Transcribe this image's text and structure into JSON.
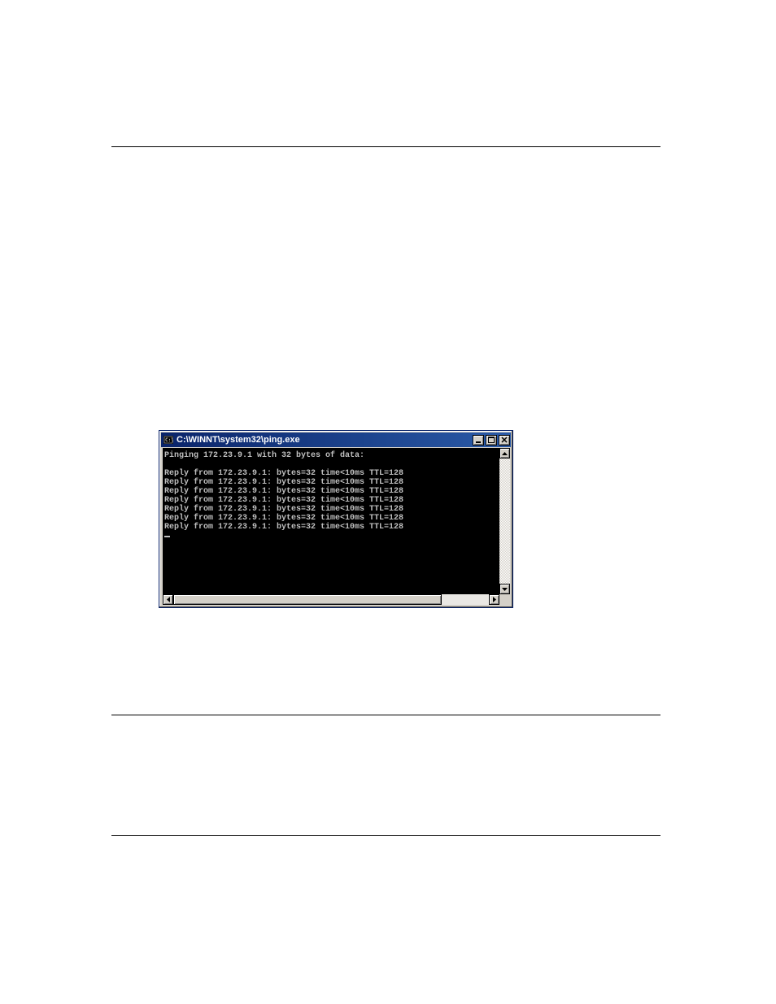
{
  "window": {
    "title": "C:\\WINNT\\system32\\ping.exe"
  },
  "console": {
    "header": "Pinging 172.23.9.1 with 32 bytes of data:",
    "lines": [
      "Reply from 172.23.9.1: bytes=32 time<10ms TTL=128",
      "Reply from 172.23.9.1: bytes=32 time<10ms TTL=128",
      "Reply from 172.23.9.1: bytes=32 time<10ms TTL=128",
      "Reply from 172.23.9.1: bytes=32 time<10ms TTL=128",
      "Reply from 172.23.9.1: bytes=32 time<10ms TTL=128",
      "Reply from 172.23.9.1: bytes=32 time<10ms TTL=128",
      "Reply from 172.23.9.1: bytes=32 time<10ms TTL=128"
    ]
  }
}
